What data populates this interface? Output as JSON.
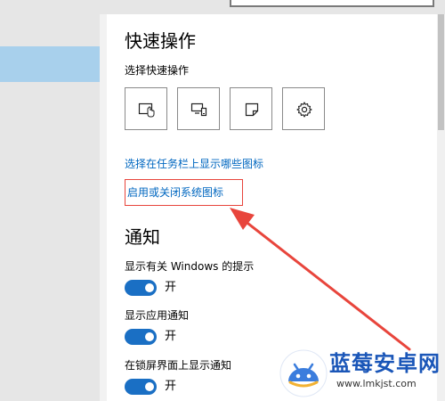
{
  "header": {
    "search_placeholder": ""
  },
  "quick_actions": {
    "title": "快速操作",
    "subtitle": "选择快速操作",
    "buttons": [
      {
        "icon": "touch-tablet-icon"
      },
      {
        "icon": "project-display-icon"
      },
      {
        "icon": "note-icon"
      },
      {
        "icon": "gear-icon"
      }
    ],
    "link_taskbar_icons": "选择在任务栏上显示哪些图标",
    "link_system_icons": "启用或关闭系统图标"
  },
  "notifications": {
    "title": "通知",
    "settings": [
      {
        "label": "显示有关 Windows 的提示",
        "state": "开",
        "on": true
      },
      {
        "label": "显示应用通知",
        "state": "开",
        "on": true
      },
      {
        "label": "在锁屏界面上显示通知",
        "state": "开",
        "on": true
      }
    ]
  },
  "annotation": {
    "color": "#e8453c"
  },
  "watermark": {
    "brand": "蓝莓安卓网",
    "url": "www.lmkjst.com"
  },
  "colors": {
    "accent": "#1a6fc4",
    "link": "#0067c0",
    "selected_nav": "#a8d0ec"
  }
}
